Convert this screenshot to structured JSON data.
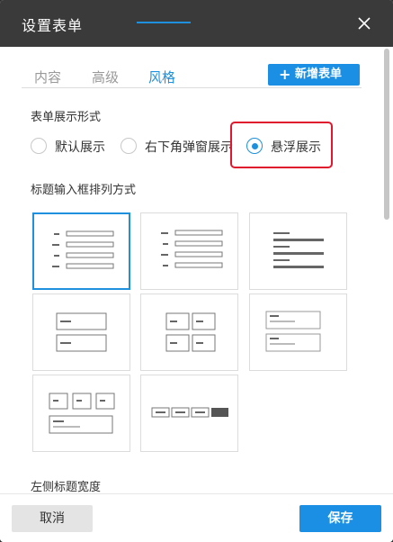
{
  "dialog": {
    "title": "设置表单",
    "close_icon": "close-icon"
  },
  "tabs": [
    {
      "label": "内容",
      "active": false
    },
    {
      "label": "高级",
      "active": false
    },
    {
      "label": "风格",
      "active": true
    }
  ],
  "add_button": {
    "icon": "plus-icon",
    "label": "新增表单"
  },
  "display_section": {
    "label": "表单展示形式",
    "options": [
      {
        "label": "默认展示",
        "checked": false
      },
      {
        "label": "右下角弹窗展示",
        "checked": false
      },
      {
        "label": "悬浮展示",
        "checked": true
      }
    ]
  },
  "title_layout_section": {
    "label": "标题输入框排列方式",
    "layouts": [
      {
        "name": "left-aligned-labels",
        "selected": true
      },
      {
        "name": "right-aligned-labels",
        "selected": false
      },
      {
        "name": "left-aligned-bold-text",
        "selected": false
      },
      {
        "name": "single-column-boxes",
        "selected": false
      },
      {
        "name": "two-column-boxes",
        "selected": false
      },
      {
        "name": "boxes-with-placeholder",
        "selected": false
      },
      {
        "name": "three-column-with-text",
        "selected": false
      },
      {
        "name": "inline-row-with-button",
        "selected": false
      }
    ]
  },
  "left_title_width_section": {
    "label": "左侧标题宽度"
  },
  "footer": {
    "cancel_label": "取消",
    "save_label": "保存"
  },
  "colors": {
    "accent": "#1a8fe3",
    "header_bg": "#3a3a3a",
    "highlight": "#e0182d"
  }
}
